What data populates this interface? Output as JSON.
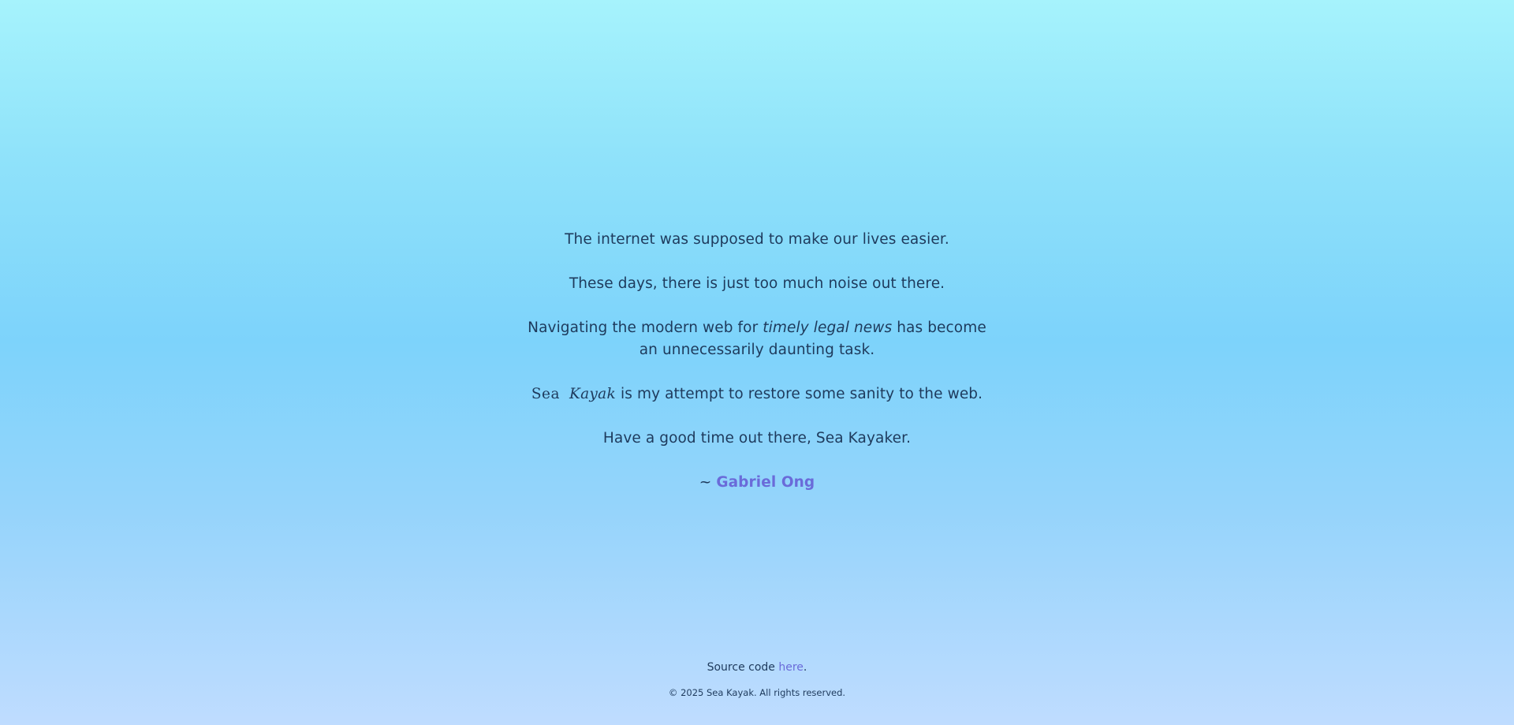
{
  "main": {
    "line1": "The internet was supposed to make our lives easier.",
    "line2": "These days, there is just too much noise out there.",
    "line3": {
      "prefix": "Navigating the modern web for ",
      "emphasis": "timely legal news",
      "suffix": " has become an unnecessarily daunting task."
    },
    "line4": {
      "brand_sea": "Sea",
      "brand_kayak": "Kayak",
      "suffix": " is my attempt to restore some sanity to the web."
    },
    "line5": "Have a good time out there, Sea Kayaker.",
    "signature": {
      "prefix": "~ ",
      "author": "Gabriel Ong"
    }
  },
  "footer": {
    "source_prefix": "Source code ",
    "source_link": "here",
    "source_suffix": ".",
    "copyright": "© 2025 Sea Kayak. All rights reserved."
  },
  "colors": {
    "text": "#1e3a5c",
    "link": "#6a6bd9",
    "gradient_top": "#a6f3fc",
    "gradient_middle": "#7dd3fb",
    "gradient_bottom": "#bfdcff"
  }
}
